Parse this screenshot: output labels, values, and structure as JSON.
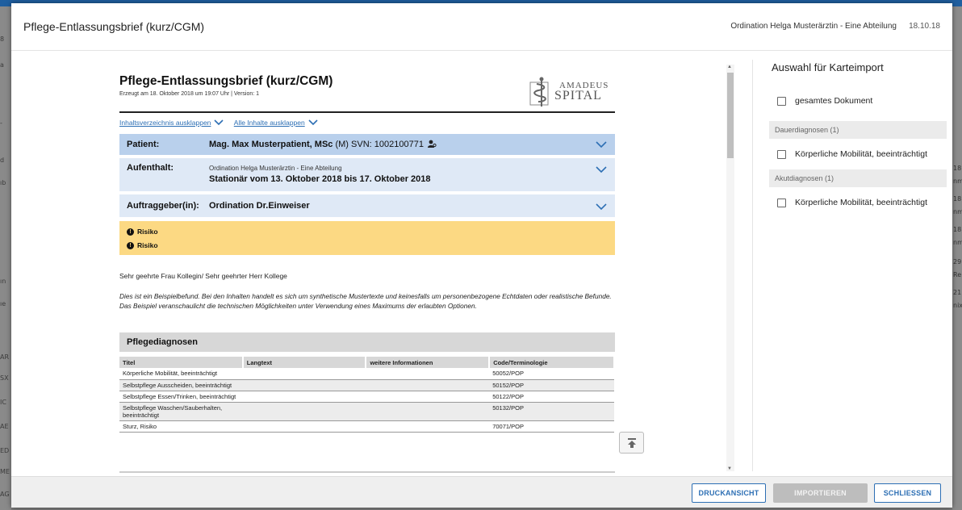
{
  "background": {
    "left_fragments": [
      "8",
      "a",
      "-",
      "d",
      "ıb",
      "ın",
      "ıe",
      "AR",
      "SX",
      "IC",
      "AE",
      "ED",
      "ME",
      "AG"
    ],
    "right_fragments": [
      "18",
      "nm",
      "18",
      "nm",
      "18",
      "nm",
      "29",
      "Re",
      "21",
      "nix"
    ]
  },
  "dialog": {
    "title": "Pflege-Entlassungsbrief (kurz/CGM)",
    "organization": "Ordination Helga Musterärztin - Eine Abteilung",
    "date": "18.10.18"
  },
  "document": {
    "title": "Pflege-Entlassungsbrief (kurz/CGM)",
    "subtitle": "Erzeugt am 18. Oktober 2018 um 19:07 Uhr | Version: 1",
    "logo": {
      "line1": "AMADEUS",
      "line2": "SPITAL"
    },
    "expand_toc": "Inhaltsverzeichnis ausklappen",
    "expand_all": "Alle Inhalte ausklappen",
    "patient": {
      "label": "Patient:",
      "name": "Mag. Max Musterpatient, MSc",
      "gender": "(M)",
      "svn": "SVN: 1002100771"
    },
    "stay": {
      "label": "Aufenthalt:",
      "org": "Ordination Helga Musterärztin - Eine Abteilung",
      "period": "Stationär vom 13. Oktober 2018 bis 17. Oktober 2018"
    },
    "orderer": {
      "label": "Auftraggeber(in):",
      "value": "Ordination Dr.Einweiser"
    },
    "risks": [
      "Risiko",
      "Risiko"
    ],
    "salutation": "Sehr geehrte Frau Kollegin/ Sehr geehrter Herr Kollege",
    "disclaimer": "Dies ist ein Beispielbefund. Bei den Inhalten handelt es sich um synthetische Mustertexte und keinesfalls um personenbezogene Echtdaten oder realistische Befunde. Das Beispiel veranschaulicht die technischen Möglichkeiten unter Verwendung eines Maximums der erlaubten Optionen.",
    "section_title": "Pflegediagnosen",
    "table": {
      "headers": [
        "Titel",
        "Langtext",
        "weitere Informationen",
        "Code/Terminologie"
      ],
      "rows": [
        [
          "Körperliche Mobilität, beeinträchtigt",
          "",
          "",
          "50052/POP"
        ],
        [
          "Selbstpflege Ausscheiden, beeinträchtigt",
          "",
          "",
          "50152/POP"
        ],
        [
          "Selbstpflege Essen/Trinken, beeinträchtigt",
          "",
          "",
          "50122/POP"
        ],
        [
          "Selbstpflege Waschen/Sauberhalten, beeinträchtigt",
          "",
          "",
          "50132/POP"
        ],
        [
          "Sturz, Risiko",
          "",
          "",
          "70071/POP"
        ]
      ]
    }
  },
  "import_panel": {
    "title": "Auswahl für Karteimport",
    "whole_document": "gesamtes Dokument",
    "groups": [
      {
        "label": "Dauerdiagnosen (1)",
        "items": [
          "Körperliche Mobilität, beeinträchtigt"
        ]
      },
      {
        "label": "Akutdiagnosen (1)",
        "items": [
          "Körperliche Mobilität, beeinträchtigt"
        ]
      }
    ]
  },
  "footer": {
    "print_view": "DRUCKANSICHT",
    "import": "IMPORTIEREN",
    "close": "SCHLIESSEN"
  },
  "colors": {
    "accent": "#2d6fb4",
    "patient_row": "#b9d0ec",
    "info_row": "#dfe9f6",
    "risk_box": "#fcd983",
    "section_head": "#d7d7d7"
  }
}
